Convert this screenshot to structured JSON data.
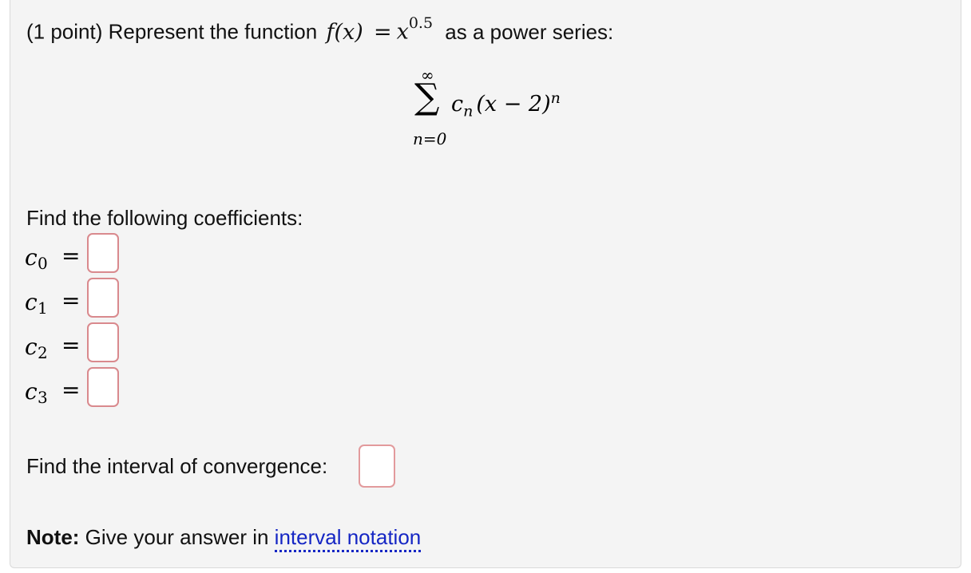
{
  "problem": {
    "points_label": "(1 point) Represent the function",
    "function_name": "f(x)",
    "equals": "=",
    "base": "x",
    "exponent": "0.5",
    "tail": "as a power series:",
    "series": {
      "upper_limit": "∞",
      "sigma": "∑",
      "term_coef": "c",
      "term_sub": "n",
      "term_body": "(x − 2)",
      "term_exp": "n",
      "lower_limit": "n=0"
    },
    "coefficients_prompt": "Find the following coefficients:",
    "coefficients": [
      {
        "symbol": "c",
        "sub": "0",
        "eq": "="
      },
      {
        "symbol": "c",
        "sub": "1",
        "eq": "="
      },
      {
        "symbol": "c",
        "sub": "2",
        "eq": "="
      },
      {
        "symbol": "c",
        "sub": "3",
        "eq": "="
      }
    ],
    "interval_prompt": "Find the interval of convergence:",
    "note_label": "Note:",
    "note_text": "Give your answer in",
    "note_link": "interval notation"
  }
}
